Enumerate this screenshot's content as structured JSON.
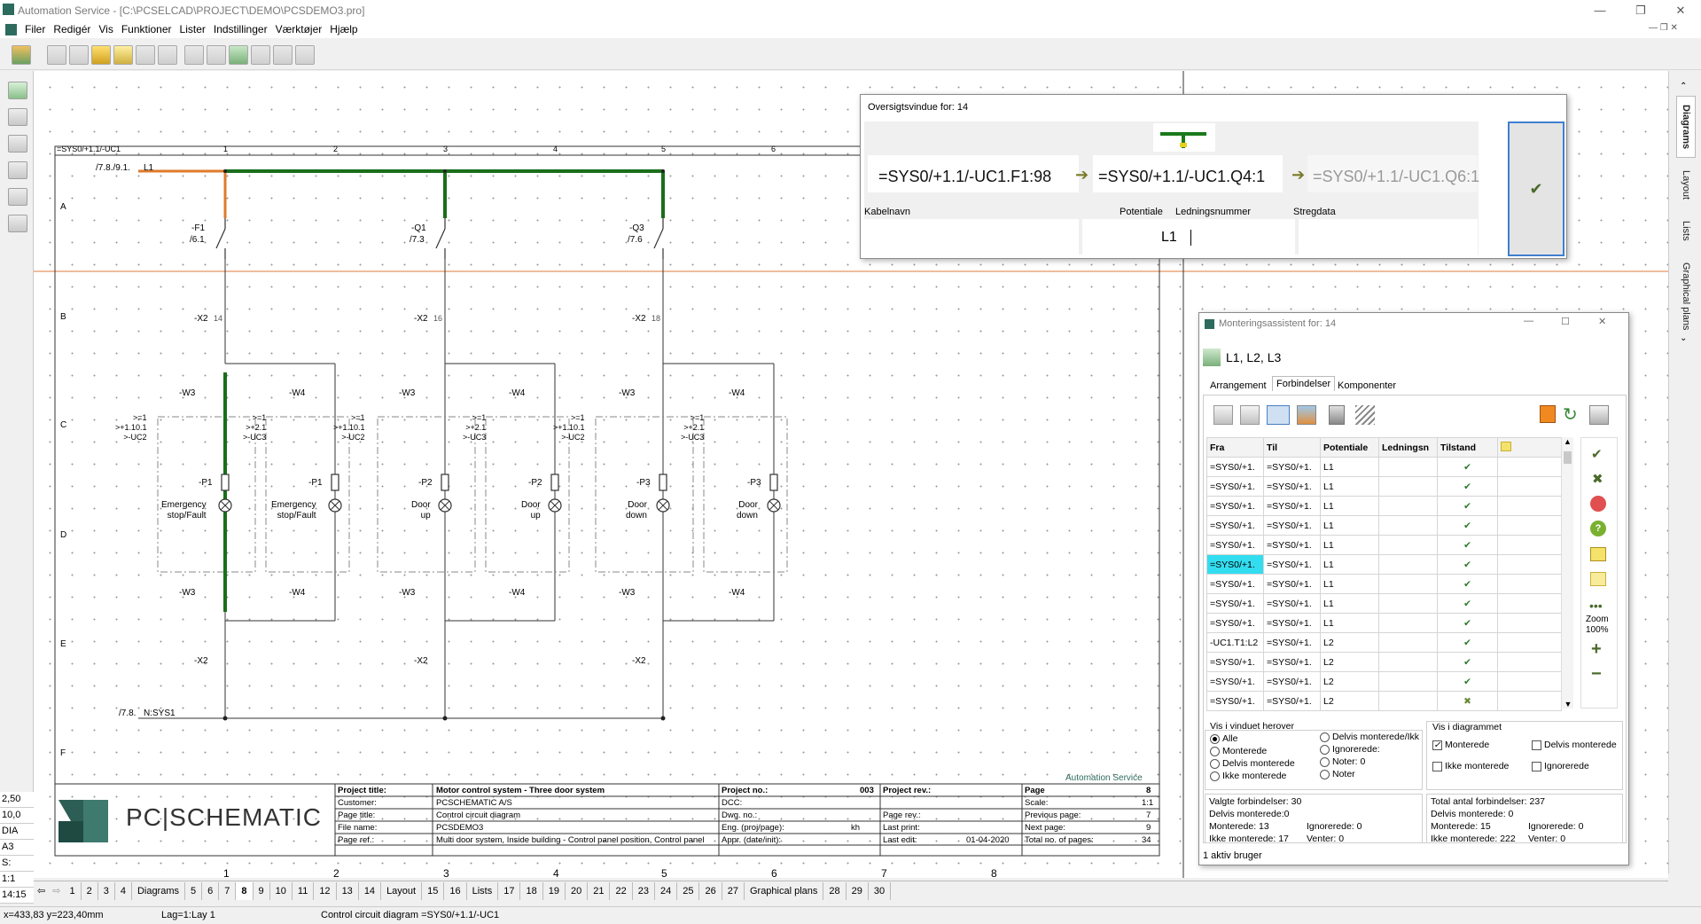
{
  "app": {
    "title": "Automation Service - [C:\\PCSELCAD\\PROJECT\\DEMO\\PCSDEMO3.pro]"
  },
  "menu": [
    "Filer",
    "Redigér",
    "Vis",
    "Funktioner",
    "Lister",
    "Indstillinger",
    "Værktøjer",
    "Hjælp"
  ],
  "overview": {
    "caption": "Oversigtsvindue for: 14",
    "from": "=SYS0/+1.1/-UC1.F1:98",
    "to": "=SYS0/+1.1/-UC1.Q4:1",
    "next": "=SYS0/+1.1/-UC1.Q6:1",
    "labels": {
      "cable": "Kabelnavn",
      "potential": "Potentiale",
      "wire": "Ledningsnummer",
      "line": "Stregdata"
    },
    "value": "L1"
  },
  "mont": {
    "caption": "Monteringsassistent for: 14",
    "title": "L1, L2, L3",
    "tabs": [
      "Arrangement",
      "Forbindelser",
      "Komponenter"
    ],
    "headers": [
      "Fra",
      "Til",
      "Potentiale",
      "Ledningsn",
      "Tilstand",
      ""
    ],
    "rows": [
      [
        "=SYS0/+1.",
        "=SYS0/+1.",
        "L1",
        "",
        "✔"
      ],
      [
        "=SYS0/+1.",
        "=SYS0/+1.",
        "L1",
        "",
        "✔"
      ],
      [
        "=SYS0/+1.",
        "=SYS0/+1.",
        "L1",
        "",
        "✔"
      ],
      [
        "=SYS0/+1.",
        "=SYS0/+1.",
        "L1",
        "",
        "✔"
      ],
      [
        "=SYS0/+1.",
        "=SYS0/+1.",
        "L1",
        "",
        "✔"
      ],
      [
        "=SYS0/+1.",
        "=SYS0/+1.",
        "L1",
        "",
        "✔"
      ],
      [
        "=SYS0/+1.",
        "=SYS0/+1.",
        "L1",
        "",
        "✔"
      ],
      [
        "=SYS0/+1.",
        "=SYS0/+1.",
        "L1",
        "",
        "✔"
      ],
      [
        "=SYS0/+1.",
        "=SYS0/+1.",
        "L1",
        "",
        "✔"
      ],
      [
        "-UC1.T1:L2",
        "=SYS0/+1.",
        "L2",
        "",
        "✔"
      ],
      [
        "=SYS0/+1.",
        "=SYS0/+1.",
        "L2",
        "",
        "✔"
      ],
      [
        "=SYS0/+1.",
        "=SYS0/+1.",
        "L2",
        "",
        "✔"
      ],
      [
        "=SYS0/+1.",
        "=SYS0/+1.",
        "L2",
        "",
        "✖"
      ]
    ],
    "zoom": "Zoom\n100%",
    "vis_vindue": {
      "title": "Vis i vinduet herover",
      "opts": [
        "Alle",
        "Monterede",
        "Delvis monterede",
        "Ikke monterede",
        "Delvis monterede/Ikk",
        "Ignorerede:",
        "Noter: 0",
        "Noter"
      ]
    },
    "vis_diagram": {
      "title": "Vis i diagrammet",
      "opts": [
        "Monterede",
        "Delvis monterede",
        "Ikke monterede",
        "Ignorerede"
      ]
    },
    "stats_left": [
      "Valgte forbindelser: 30",
      "Delvis monterede:0",
      "Monterede: 13",
      "Ignorerede: 0",
      "Ikke monterede: 17",
      "Venter: 0"
    ],
    "stats_right": [
      "Total antal forbindelser: 237",
      "Delvis monterede: 0",
      "Monterede: 15",
      "Ignorerede: 0",
      "Ikke monterede: 222",
      "Venter: 0"
    ],
    "status": "1 aktiv bruger"
  },
  "schematic": {
    "frame_label": "=SYS0/+1.1/-UC1",
    "col_numbers": [
      "1",
      "2",
      "3",
      "4",
      "5",
      "6",
      "7",
      "8"
    ],
    "row_letters": [
      "A",
      "B",
      "C",
      "D",
      "E",
      "F"
    ],
    "ref_top": "/7.8./9.1.",
    "l1": "L1",
    "ref_bottom": "/7.8.",
    "n_label": "N:SYS1",
    "devices": [
      "-F1",
      "-Q1",
      "-Q3"
    ],
    "dev_refs": [
      "/6.1",
      "/7.3",
      "/7.6"
    ],
    "terminals": [
      "98",
      "97",
      "63",
      "64",
      "63",
      "64"
    ],
    "x2": [
      "-X2",
      "-X2",
      "-X2"
    ],
    "x2_nums": [
      "14",
      "16",
      "18"
    ],
    "w": [
      "-W3",
      "-W4",
      "-W3",
      "-W4",
      "-W3",
      "-W4"
    ],
    "w_nums": [
      "7",
      "7",
      "9",
      "9",
      "11",
      "11"
    ],
    "uc": [
      ">=1\n>+1.10.1\n>-UC2",
      ">=1\n>+2.1\n>-UC3",
      ">=1\n>+1.10.1\n>-UC2",
      ">=1\n>+2.1\n>-UC3",
      ">=1\n>+1.10.1\n>-UC2",
      ">=1\n>+2.1\n>-UC3"
    ],
    "lamps": [
      "-P1",
      "-P1",
      "-P2",
      "-P2",
      "-P3",
      "-P3"
    ],
    "lamp_texts": [
      "Emergency\nstop/Fault",
      "Emergency\nstop/Fault",
      "Door\nup",
      "Door\nup",
      "Door\ndown",
      "Door\ndown"
    ],
    "w_bottom": [
      "-W3",
      "-W4",
      "-W3",
      "-W4",
      "-W3",
      "-W4"
    ],
    "w_bottom_nums": [
      "8",
      "8",
      "10",
      "10",
      "12",
      "12"
    ],
    "x2_bottom": [
      "-X2",
      "-X2",
      "-X2"
    ],
    "x2_bottom_nums": [
      "13",
      "15",
      "17"
    ],
    "company": "Automation Service",
    "logo": "PC|SCHEMATIC",
    "titleblock": {
      "project_title_k": "Project title:",
      "project_title_v": "Motor control system - Three door system",
      "customer_k": "Customer:",
      "customer_v": "PCSCHEMATIC A/S",
      "page_title_k": "Page title:",
      "page_title_v": "Control circuit diagram",
      "file_name_k": "File name:",
      "file_name_v": "PCSDEMO3",
      "page_ref_k": "Page ref.:",
      "page_ref_v": "Multi door system, Inside building - Control panel position, Control panel",
      "project_no_k": "Project no.:",
      "project_no_v": "003",
      "dcc_k": "DCC:",
      "dwg_k": "Dwg. no.:",
      "eng_k": "Eng. (proj/page):",
      "eng_v": "kh",
      "app_k": "Appr. (date/init):",
      "project_rev_k": "Project rev.:",
      "page_rev_k": "Page rev.:",
      "last_print_k": "Last print:",
      "last_edit_k": "Last edit:",
      "last_edit_v": "01-04-2020",
      "page_k": "Page",
      "page_v": "8",
      "scale_k": "Scale:",
      "scale_v": "1:1",
      "prev_k": "Previous page:",
      "prev_v": "7",
      "next_k": "Next page:",
      "next_v": "9",
      "total_k": "Total no. of pages:",
      "total_v": "34"
    }
  },
  "pagetabs": [
    "1",
    "2",
    "3",
    "4",
    "Diagrams",
    "5",
    "6",
    "7",
    "8",
    "9",
    "10",
    "11",
    "12",
    "13",
    "14",
    "Layout",
    "15",
    "16",
    "Lists",
    "17",
    "18",
    "19",
    "20",
    "21",
    "22",
    "23",
    "24",
    "25",
    "26",
    "27",
    "Graphical plans",
    "28",
    "29",
    "30"
  ],
  "left_status": [
    "2,50",
    "10,0",
    "DIA",
    "A3",
    "S:",
    "1:1",
    "14:15"
  ],
  "bottombar": {
    "coords": "x=433,83 y=223,40mm",
    "layer": "Lag=1:Lay 1",
    "info": "Control circuit diagram  =SYS0/+1.1/-UC1"
  },
  "sidetabs": [
    "Diagrams",
    "Layout",
    "Lists",
    "Graphical plans"
  ]
}
